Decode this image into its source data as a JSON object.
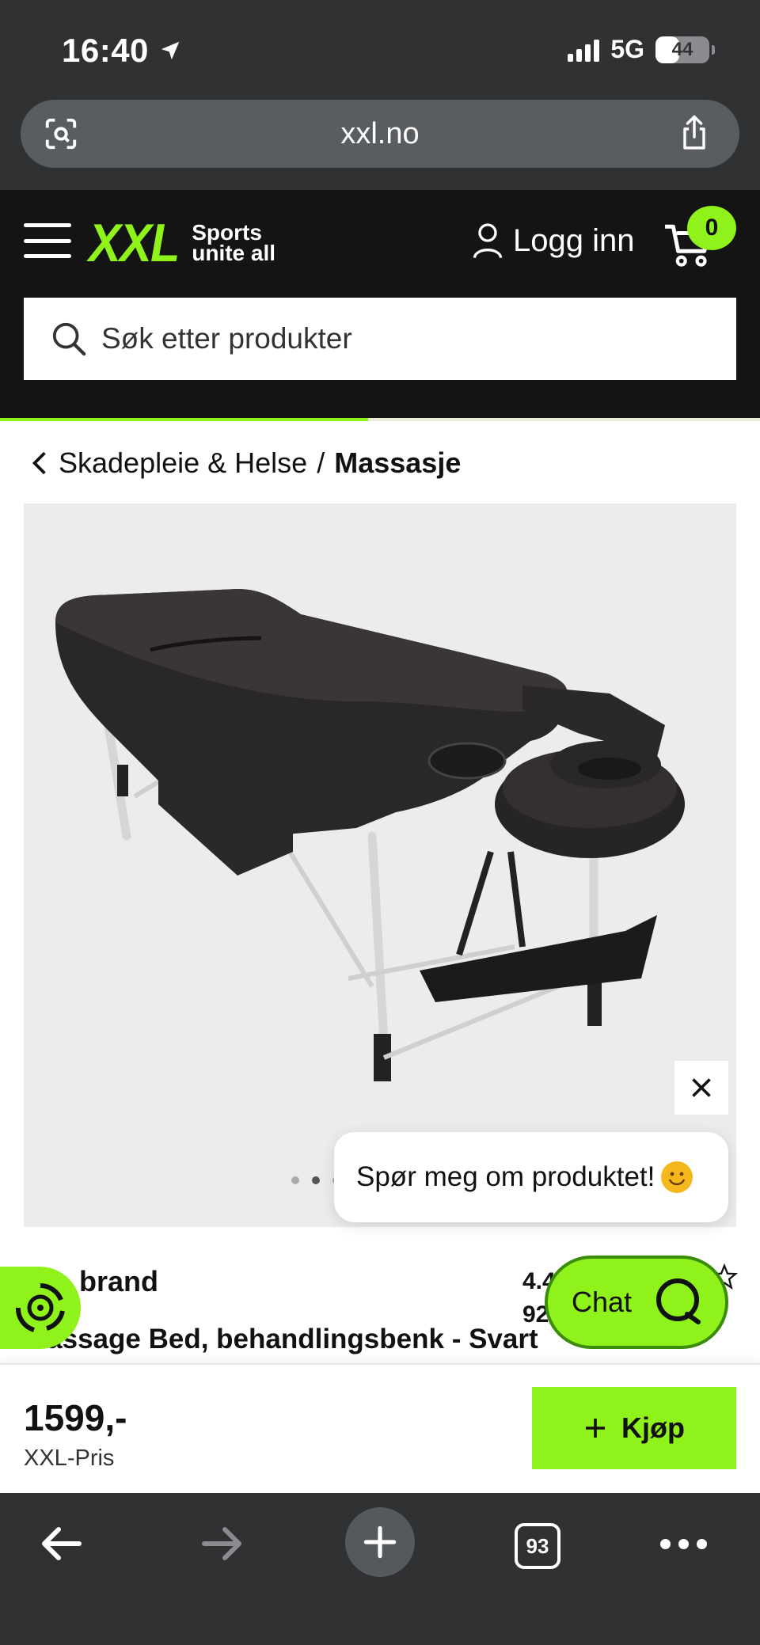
{
  "status_bar": {
    "time": "16:40",
    "network": "5G",
    "battery": "44",
    "battery_level_percent": 44
  },
  "browser": {
    "url": "xxl.no",
    "tab_count": "93"
  },
  "header": {
    "logo": "XXL",
    "tagline_line1": "Sports",
    "tagline_line2": "unite all",
    "login_label": "Logg inn",
    "cart_count": "0",
    "accent_color": "#8ff21b"
  },
  "search": {
    "placeholder": "Søk etter produkter"
  },
  "breadcrumb": {
    "parent": "Skadepleie & Helse",
    "separator": "/",
    "current": "Massasje"
  },
  "product": {
    "image_alt": "Massage Bed, behandlingsbenk - Svart",
    "gallery_dots": 3,
    "active_dot": 2,
    "brand": "brand",
    "rating_line1": "4.4",
    "rating_line2": "92",
    "title": "Massage Bed, behandlingsbenk - Svart"
  },
  "chat": {
    "bubble_text": "Spør meg om produktet!",
    "button_label": "Chat"
  },
  "buy": {
    "price": "1599,-",
    "price_label": "XXL-Pris",
    "button_label": "Kjøp"
  },
  "icons": {
    "location": "location-arrow-icon",
    "camera_search": "camera-search-icon",
    "share": "share-icon",
    "menu": "hamburger-icon",
    "user": "user-icon",
    "cart": "cart-icon",
    "search": "search-icon",
    "back": "chevron-left-icon",
    "close": "close-icon",
    "star": "star-icon",
    "chat": "chat-icon",
    "plus": "plus-icon"
  }
}
